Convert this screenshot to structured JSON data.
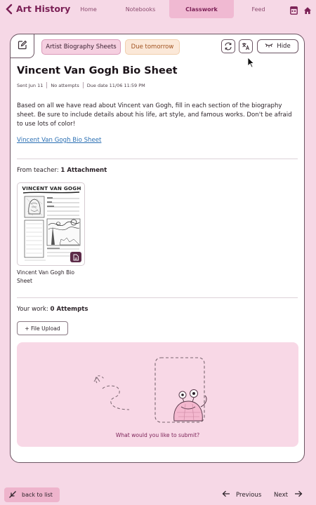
{
  "nav": {
    "app_title": "Art History",
    "tabs": [
      {
        "label": "Home"
      },
      {
        "label": "Notebooks"
      },
      {
        "label": "Classwork",
        "active": true
      },
      {
        "label": "Feed"
      }
    ],
    "icons": [
      "calendar-icon",
      "home-icon"
    ]
  },
  "assignment": {
    "type_chip": "Artist Biography Sheets",
    "due_chip": "Due tomorrow",
    "hide_label": "Hide",
    "title": "Vincent Van Gogh Bio Sheet",
    "meta": {
      "sent": "Sent Jun 11",
      "attempts": "No attempts",
      "due": "Due date 11/06 11:59 PM"
    },
    "description": "Based on all we have read about Vincent van Gogh, fill in each section of the biography sheet. Be sure to include details about his life, art style, and famous works. Don't be afraid to use lots of color!",
    "link_text": "Vincent Van Gogh Bio Sheet"
  },
  "teacher": {
    "prefix": "From teacher:",
    "count_text": "1 Attachment",
    "attachment": {
      "thumb_title": "VINCENT VAN GOGH",
      "name": "Vincent Van Gogh Bio Sheet"
    }
  },
  "work": {
    "prefix": "Your work:",
    "count_text": "0 Attempts",
    "upload_label": "+ File Upload",
    "submit_prompt": "What would you like to submit?"
  },
  "footer": {
    "back_label": "back to list",
    "prev_label": "Previous",
    "next_label": "Next"
  },
  "colors": {
    "background": "#f6d8e6",
    "accent": "#7a1f55",
    "active_tab": "#f0b9d2",
    "type_chip": "#f5cfe0",
    "due_chip": "#fbe8d8",
    "due_text": "#a0521f",
    "link": "#2a6fb3"
  }
}
